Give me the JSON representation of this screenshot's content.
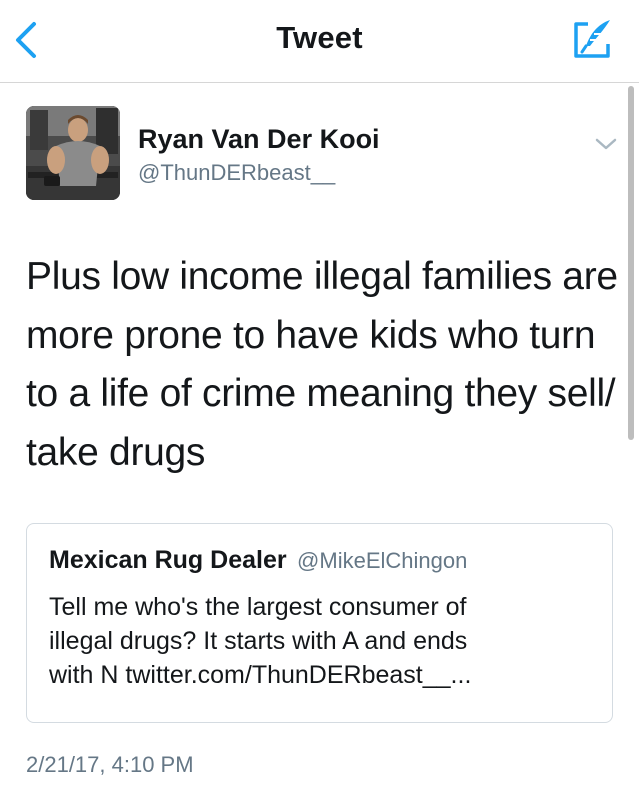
{
  "navbar": {
    "title": "Tweet",
    "back_icon": "chevron-left-icon",
    "compose_icon": "compose-icon"
  },
  "tweet": {
    "author": {
      "name": "Ryan Van Der Kooi",
      "handle": "@ThunDERbeast__"
    },
    "text_lines": [
      "Plus low income illegal families are",
      "more prone to have kids who turn",
      "to a life of crime meaning they sell/",
      "take drugs"
    ],
    "timestamp": "2/21/17, 4:10 PM"
  },
  "quoted": {
    "name": "Mexican Rug Dealer",
    "handle": "@MikeElChingon",
    "text_lines": [
      "Tell me who's the largest consumer of",
      "illegal drugs? It starts with A and ends",
      "with N twitter.com/ThunDERbeast__..."
    ]
  },
  "colors": {
    "accent": "#1da1f2",
    "secondary_text": "#657786",
    "primary_text": "#14171a",
    "border": "#d4dbe1"
  }
}
